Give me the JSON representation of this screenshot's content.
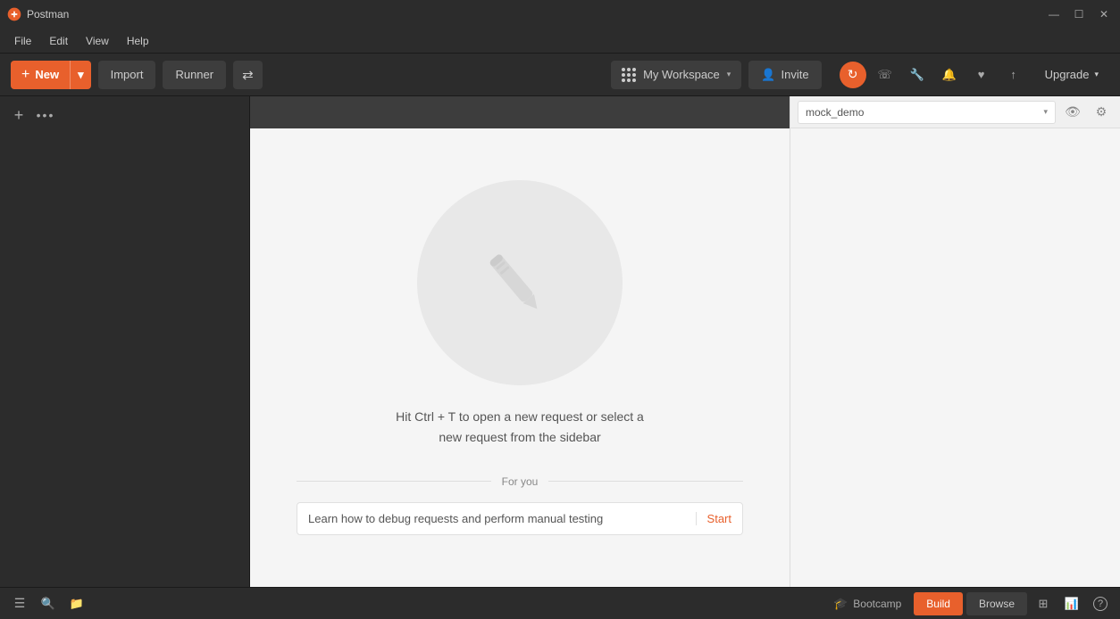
{
  "app": {
    "title": "Postman",
    "logo": "🟠"
  },
  "window_controls": {
    "minimize": "—",
    "maximize": "☐",
    "close": "✕"
  },
  "menu": {
    "items": [
      "File",
      "Edit",
      "View",
      "Help"
    ]
  },
  "toolbar": {
    "new_label": "New",
    "import_label": "Import",
    "runner_label": "Runner",
    "workspace_label": "My Workspace",
    "invite_label": "Invite",
    "upgrade_label": "Upgrade"
  },
  "sidebar": {
    "add_tooltip": "+",
    "more_tooltip": "•••"
  },
  "right_panel": {
    "env_placeholder": "mock_demo",
    "eye_icon": "👁",
    "gear_icon": "⚙"
  },
  "empty_state": {
    "primary_text": "Hit Ctrl + T to open a new request or select a\nnew request from the sidebar",
    "for_you_label": "For you",
    "learn_text": "Learn how to debug requests and perform manual testing",
    "start_label": "Start"
  },
  "bottom_bar": {
    "bootcamp_label": "Bootcamp",
    "build_label": "Build",
    "browse_label": "Browse"
  },
  "icons": {
    "plus": "+",
    "dots": "•••",
    "grid": "⊞",
    "chevron_down": "▾",
    "user_plus": "👤+",
    "sync": "↻",
    "phone": "☎",
    "wrench": "🔧",
    "bell": "🔔",
    "heart": "♥",
    "upload": "↑",
    "eye": "👁",
    "gear": "⚙",
    "sidebar_toggle": "☰",
    "search": "🔍",
    "collection": "📁",
    "bootcamp_icon": "🎓",
    "layout": "⊞",
    "graph": "📊",
    "question": "?"
  }
}
